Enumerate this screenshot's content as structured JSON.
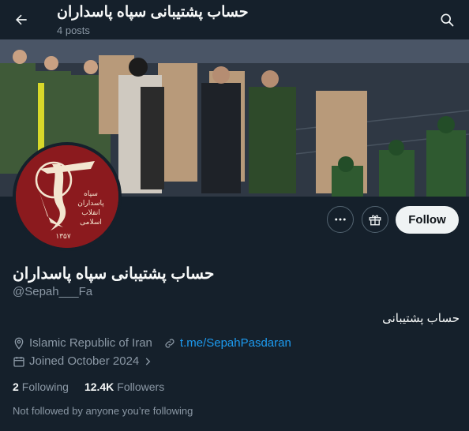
{
  "header": {
    "title": "حساب پشتیبانی سپاه پاسداران",
    "posts_count": "4 posts"
  },
  "banner": {
    "description": ""
  },
  "avatar": {
    "emblem_text_lines": [
      "سپاه",
      "پاسداران",
      "انقلاب",
      "اسلامی"
    ],
    "year": "۱۳۵۷",
    "bg_color": "#8b1a1e"
  },
  "actions": {
    "follow_label": "Follow"
  },
  "profile": {
    "display_name": "حساب پشتیبانی سپاه پاسداران",
    "handle": "@Sepah___Fa",
    "bio": "حساب پشتیبانی",
    "location": "Islamic Republic of Iran",
    "link": "t.me/SepahPasdaran",
    "joined": "Joined October 2024"
  },
  "stats": {
    "following_count": "2",
    "following_label": "Following",
    "followers_count": "12.4K",
    "followers_label": "Followers"
  },
  "footer": {
    "not_followed": "Not followed by anyone you’re following"
  },
  "colors": {
    "background": "#15202b",
    "accent": "#1d9bf0",
    "secondary_text": "#8b98a5"
  }
}
